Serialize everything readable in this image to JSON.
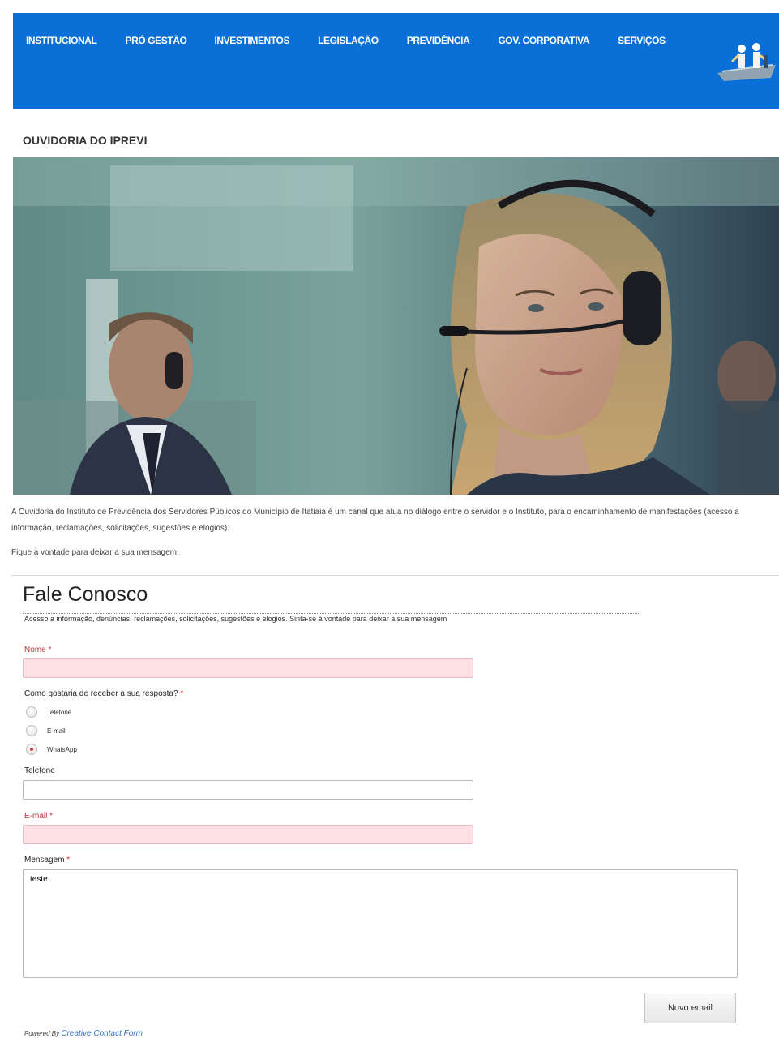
{
  "nav": {
    "items": [
      {
        "label": "INSTITUCIONAL"
      },
      {
        "label": "PRÓ GESTÃO"
      },
      {
        "label": "INVESTIMENTOS"
      },
      {
        "label": "LEGISLAÇÃO"
      },
      {
        "label": "PREVIDÊNCIA"
      },
      {
        "label": "GOV. CORPORATIVA"
      },
      {
        "label": "SERVIÇOS"
      }
    ]
  },
  "page": {
    "title": "OUVIDORIA DO IPREVI",
    "intro_1": "A Ouvidoria do Instituto de Previdência dos Servidores Públicos do Município de Itatiaia é um canal que atua no diálogo entre o servidor e o Instituto, para o encaminhamento de manifestações (acesso a informação, reclamações, solicitações, sugestões e elogios).",
    "intro_2": "Fique à vontade para deixar a sua mensagem."
  },
  "form": {
    "title": "Fale Conosco",
    "description": "Acesso a informação, denúncias, reclamações, solicitações, sugestões e elogios. Sinta-se à vontade para deixar a sua mensagem",
    "required_mark": "*",
    "nome": {
      "label": "Nome",
      "value": ""
    },
    "response_question": "Como gostaria de receber a sua resposta?",
    "response_options": [
      {
        "label": "Telefone",
        "selected": false
      },
      {
        "label": "E-mail",
        "selected": false
      },
      {
        "label": "WhatsApp",
        "selected": true
      }
    ],
    "telefone": {
      "label": "Telefone",
      "value": ""
    },
    "email": {
      "label": "E-mail",
      "value": ""
    },
    "mensagem": {
      "label": "Mensagem",
      "value": "teste"
    },
    "submit_label": "Novo email",
    "powered_by": "Powered By",
    "powered_link": "Creative Contact Form"
  },
  "colors": {
    "header_blue": "#0a6fd6",
    "error_field": "#fde0e3",
    "required_star": "#dd3333"
  }
}
